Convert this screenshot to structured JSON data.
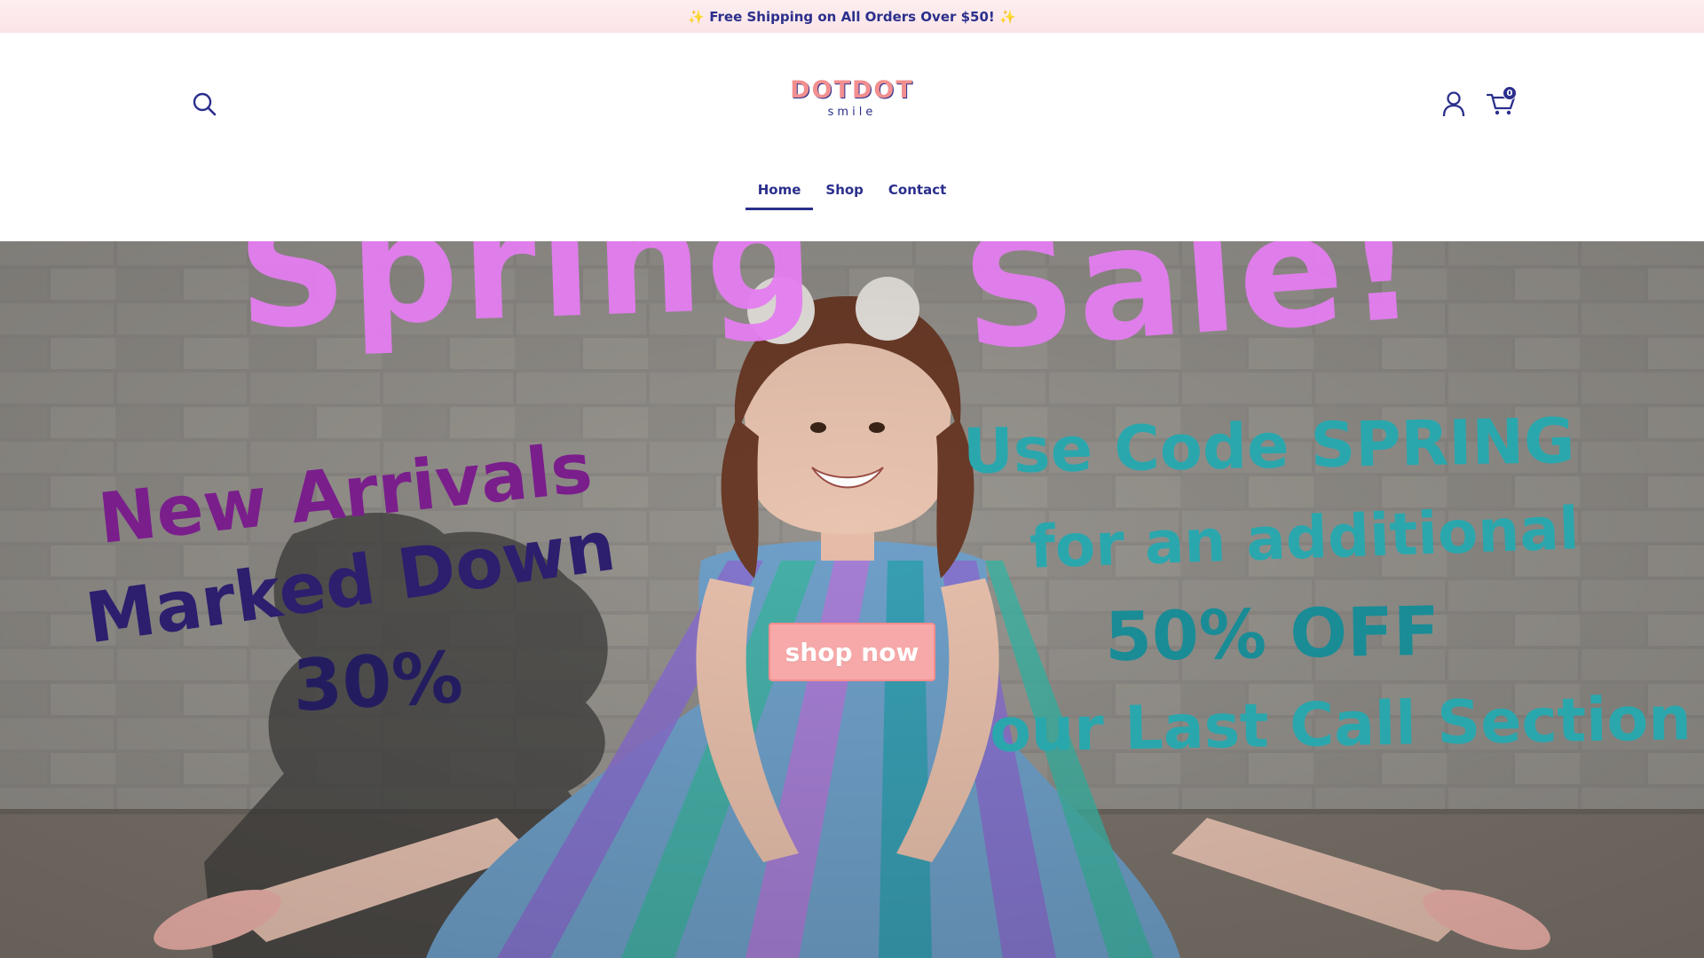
{
  "announcement": {
    "text": "✨ Free Shipping on All Orders Over $50! ✨"
  },
  "header": {
    "logo_main": "DOTDOT",
    "logo_sub": "smile",
    "cart_count": "0",
    "icons": {
      "search": "search-icon",
      "account": "user-icon",
      "cart": "shopping-cart-icon"
    }
  },
  "nav": {
    "items": [
      {
        "label": "Home",
        "active": true
      },
      {
        "label": "Shop",
        "active": false
      },
      {
        "label": "Contact",
        "active": false
      }
    ]
  },
  "hero": {
    "headline_left": "Spring",
    "headline_right": "Sale!",
    "promo_left": [
      "New Arrivals",
      "Marked Down",
      "30%"
    ],
    "promo_right": [
      "Use Code SPRING",
      "for an additional",
      "50% OFF",
      "our Last Call Section"
    ],
    "cta_label": "shop now"
  },
  "colors": {
    "brand_navy": "#2b2f8c",
    "brand_pink": "#f28f8f",
    "announcement_bg": "#fdeef0",
    "cta_bg": "#f7a8a8",
    "graffiti_pink": "#e47df0",
    "graffiti_purple": "#7a1e8c",
    "graffiti_teal": "#2aa7ad"
  }
}
